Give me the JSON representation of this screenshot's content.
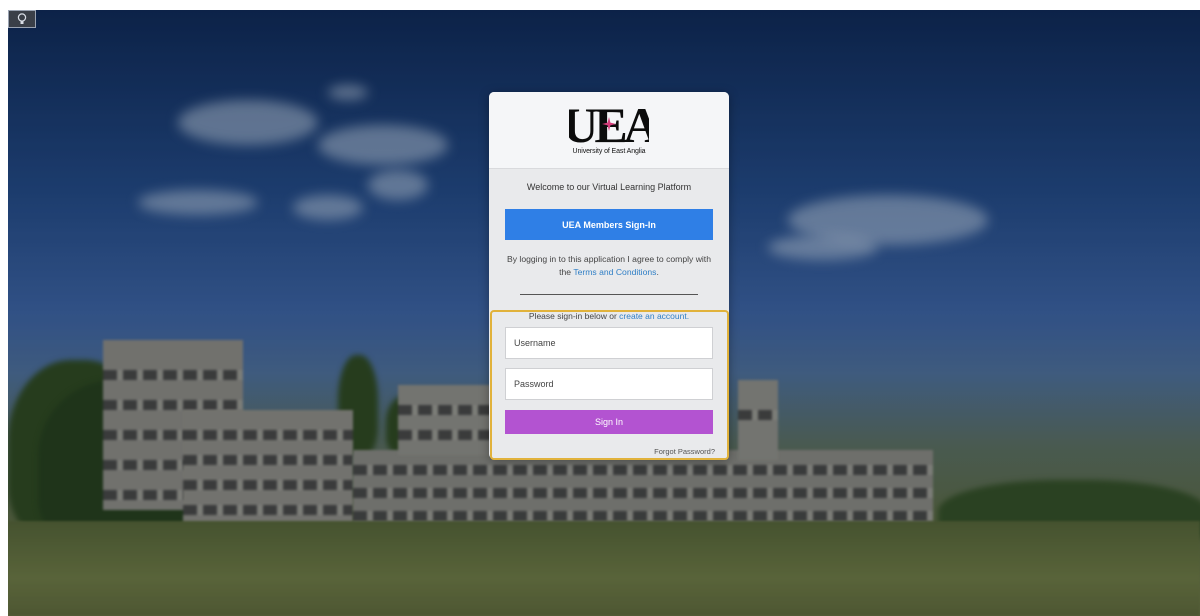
{
  "logo": {
    "mark": "UEA",
    "name": "University of East Anglia"
  },
  "welcome_text": "Welcome to our Virtual Learning Platform",
  "members_button": "UEA Members Sign-In",
  "agreement": {
    "prefix": "By logging in to this application I agree to comply with the",
    "link": "Terms and Conditions",
    "suffix": "."
  },
  "signin": {
    "prompt_prefix": "Please sign-in below or",
    "prompt_link": "create an account",
    "prompt_suffix": ".",
    "username_placeholder": "Username",
    "password_placeholder": "Password",
    "button": "Sign In",
    "forgot": "Forgot Password?"
  },
  "colors": {
    "members_button": "#2f7fe6",
    "signin_button": "#b353d1",
    "highlight": "#e1b23b",
    "link": "#2f7fc6",
    "logo_star": "#d63c7a"
  }
}
